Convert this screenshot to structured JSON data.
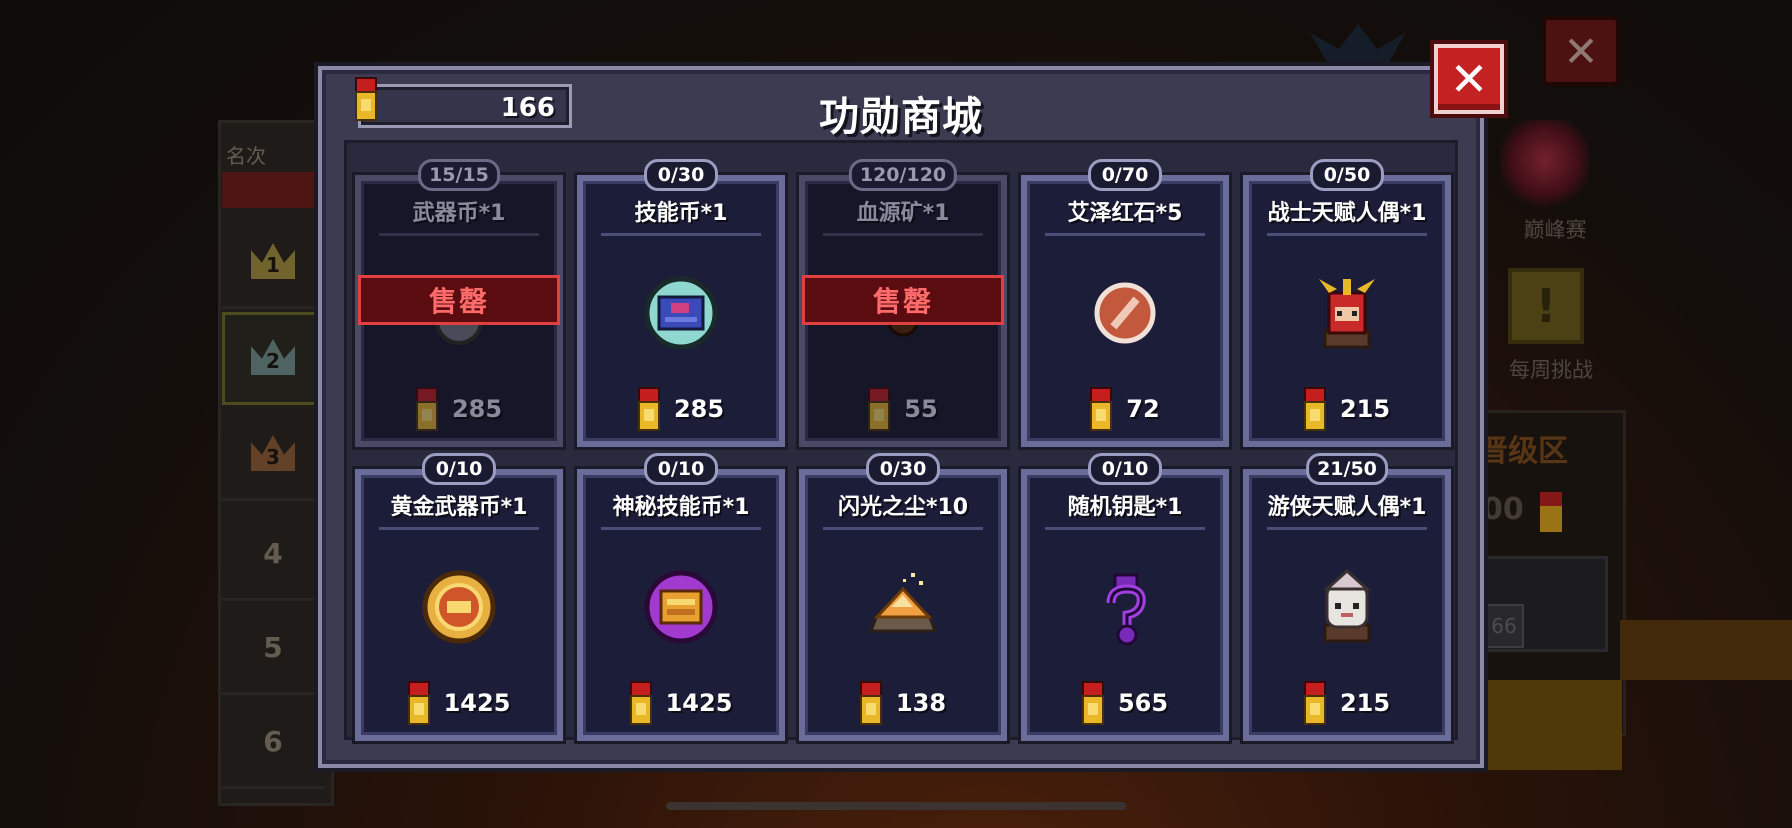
{
  "modal": {
    "title": "功勋商城",
    "balance": "166",
    "close_label": "✕"
  },
  "items": [
    {
      "limit": "15/15",
      "name": "武器币*1",
      "price": "285",
      "sold_out": true,
      "icon": "weapon-coin-icon"
    },
    {
      "limit": "0/30",
      "name": "技能币*1",
      "price": "285",
      "sold_out": false,
      "icon": "skill-coin-icon"
    },
    {
      "limit": "120/120",
      "name": "血源矿*1",
      "price": "55",
      "sold_out": true,
      "icon": "blood-ore-icon"
    },
    {
      "limit": "0/70",
      "name": "艾泽红石*5",
      "price": "72",
      "sold_out": false,
      "icon": "red-stone-icon"
    },
    {
      "limit": "0/50",
      "name": "战士天赋人偶*1",
      "price": "215",
      "sold_out": false,
      "icon": "warrior-doll-icon"
    },
    {
      "limit": "0/10",
      "name": "黄金武器币*1",
      "price": "1425",
      "sold_out": false,
      "icon": "gold-weapon-coin-icon"
    },
    {
      "limit": "0/10",
      "name": "神秘技能币*1",
      "price": "1425",
      "sold_out": false,
      "icon": "mystic-skill-coin-icon"
    },
    {
      "limit": "0/30",
      "name": "闪光之尘*10",
      "price": "138",
      "sold_out": false,
      "icon": "flash-dust-icon"
    },
    {
      "limit": "0/10",
      "name": "随机钥匙*1",
      "price": "565",
      "sold_out": false,
      "icon": "random-key-icon"
    },
    {
      "limit": "21/50",
      "name": "游侠天赋人偶*1",
      "price": "215",
      "sold_out": false,
      "icon": "ranger-doll-icon"
    }
  ],
  "sold_out_label": "售罄",
  "background": {
    "rank_header": "名次",
    "ranks": [
      "1",
      "2",
      "3",
      "4",
      "5",
      "6"
    ],
    "peak_label": "巅峰赛",
    "weekly_label": "每周挑战",
    "zone_label": "晋级区",
    "zone_number": "00",
    "zone_pill": "66",
    "bg_close_label": "✕"
  },
  "colors": {
    "card_border": "#6a6c9a",
    "soldout_red": "#e04040",
    "close_red": "#c42222",
    "medal_gold": "#e8b828"
  }
}
